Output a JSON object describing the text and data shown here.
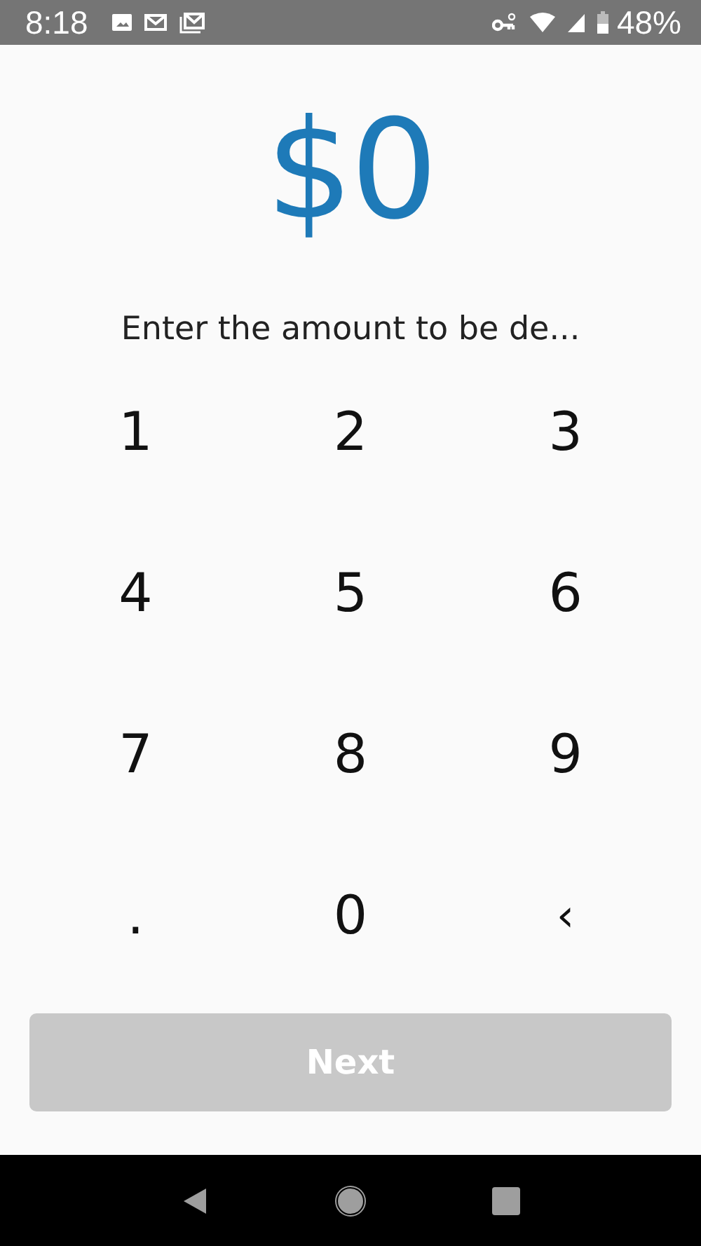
{
  "status_bar": {
    "time": "8:18",
    "battery": "48%"
  },
  "amount": "$0",
  "prompt": "Enter the amount to be de...",
  "keypad": [
    {
      "label": "1",
      "kind": "digit"
    },
    {
      "label": "2",
      "kind": "digit"
    },
    {
      "label": "3",
      "kind": "digit"
    },
    {
      "label": "4",
      "kind": "digit"
    },
    {
      "label": "5",
      "kind": "digit"
    },
    {
      "label": "6",
      "kind": "digit"
    },
    {
      "label": "7",
      "kind": "digit"
    },
    {
      "label": "8",
      "kind": "digit"
    },
    {
      "label": "9",
      "kind": "digit"
    },
    {
      "label": ".",
      "kind": "decimal"
    },
    {
      "label": "0",
      "kind": "digit"
    },
    {
      "label": "‹",
      "kind": "backspace"
    }
  ],
  "next_button": {
    "label": "Next",
    "disabled": true
  }
}
